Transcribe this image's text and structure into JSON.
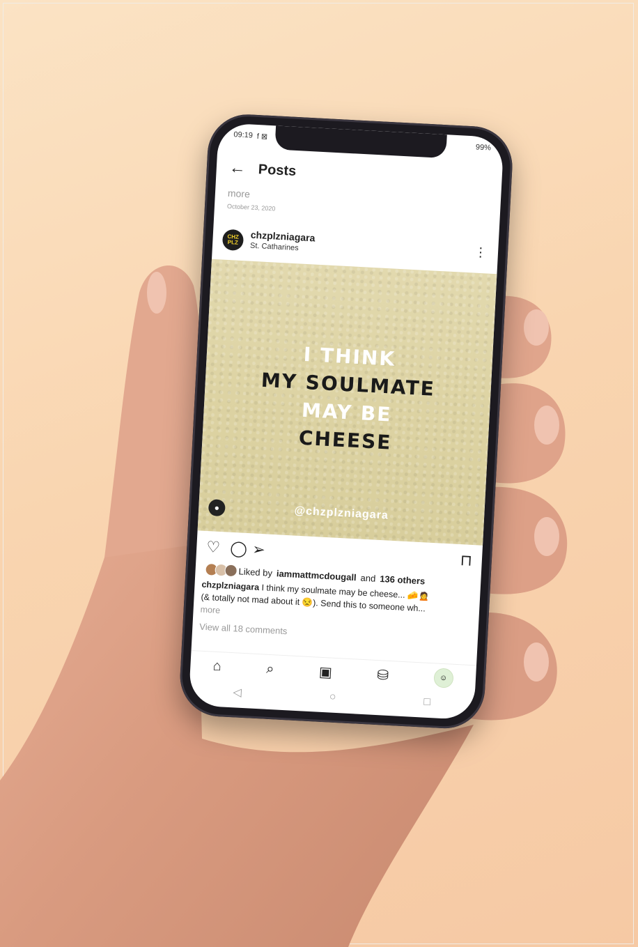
{
  "statusbar": {
    "time": "09:19",
    "notif_icons": "f ⊠",
    "right": "99%"
  },
  "header": {
    "back_icon": "back-arrow-icon",
    "title": "Posts"
  },
  "truncated_text": "more",
  "date": "October 23, 2020",
  "post": {
    "avatar_text": "CHZ PLZ",
    "username": "chzplzniagara",
    "location": "St. Catharines",
    "image": {
      "lines": [
        "I THINK",
        "MY SOULMATE",
        "MAY BE",
        "CHEESE"
      ],
      "handle": "@chzplzniagara"
    },
    "likes": {
      "prefix": "Liked by",
      "user": "iammattmcdougall",
      "middle": "and",
      "others": "136 others"
    },
    "caption": {
      "author": "chzplzniagara",
      "line1": "I think my soulmate may be cheese... 🧀🙍",
      "line2": "(& totally not mad about it 😒). Send this to someone wh...",
      "more": "more"
    },
    "comments_link": "View all 18 comments"
  },
  "tabbar": [
    "home-icon",
    "search-icon",
    "reels-icon",
    "shop-icon",
    "profile-icon"
  ],
  "navbar": [
    "back-triangle-icon",
    "home-circle-icon",
    "recents-square-icon"
  ],
  "colors": {
    "background": "#f9d5b0",
    "post_bg": "#ddd3a3",
    "text": "#222222",
    "muted": "#999999"
  }
}
